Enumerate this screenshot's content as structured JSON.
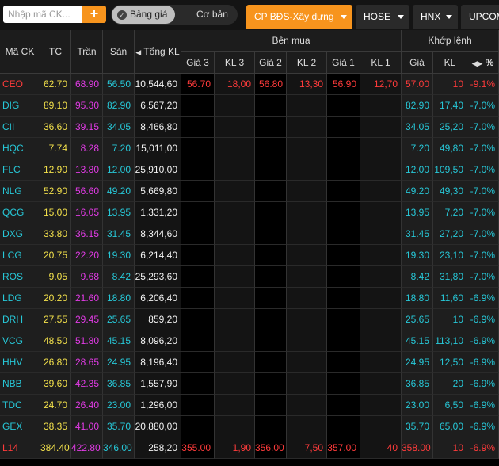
{
  "search": {
    "placeholder": "Nhập mã CK..."
  },
  "add_button": "+",
  "view_toggle": {
    "active": "Bảng giá",
    "other": "Cơ bản"
  },
  "tabs": [
    {
      "label": "CP BĐS-Xây dựng",
      "active": true
    },
    {
      "label": "HOSE",
      "active": false
    },
    {
      "label": "HNX",
      "active": false
    },
    {
      "label": "UPCOM",
      "active": false
    }
  ],
  "headers": {
    "symbol": "Mã CK",
    "ref": "TC",
    "ceiling": "Trần",
    "floor": "Sàn",
    "total_vol": "Tổng KL",
    "buy_group": "Bên mua",
    "match_group": "Khớp lệnh",
    "price3": "Giá 3",
    "vol3": "KL 3",
    "price2": "Giá 2",
    "vol2": "KL 2",
    "price1": "Giá 1",
    "vol1": "KL 1",
    "match_price": "Giá",
    "match_vol": "KL",
    "pct": "%"
  },
  "colors": {
    "accent": "#f7941d",
    "ref": "#f2e04b",
    "ceiling": "#e23be6",
    "floor": "#27c8d8",
    "up": "#ff3b3b"
  },
  "rows": [
    {
      "sym": "CEO",
      "tc": "62.70",
      "tran": "68.90",
      "san": "56.50",
      "tkl": "10,544,60",
      "g3": "56.70",
      "kl3": "18,00",
      "g2": "56.80",
      "kl2": "13,30",
      "g1": "56.90",
      "kl1": "12,70",
      "gia": "57.00",
      "kl": "10",
      "pct": "-9.1%",
      "status": "up"
    },
    {
      "sym": "DIG",
      "tc": "89.10",
      "tran": "95.30",
      "san": "82.90",
      "tkl": "6,567,20",
      "g3": "",
      "kl3": "",
      "g2": "",
      "kl2": "",
      "g1": "",
      "kl1": "",
      "gia": "82.90",
      "kl": "17,40",
      "pct": "-7.0%",
      "status": "floor"
    },
    {
      "sym": "CII",
      "tc": "36.60",
      "tran": "39.15",
      "san": "34.05",
      "tkl": "8,466,80",
      "g3": "",
      "kl3": "",
      "g2": "",
      "kl2": "",
      "g1": "",
      "kl1": "",
      "gia": "34.05",
      "kl": "25,20",
      "pct": "-7.0%",
      "status": "floor"
    },
    {
      "sym": "HQC",
      "tc": "7.74",
      "tran": "8.28",
      "san": "7.20",
      "tkl": "15,011,00",
      "g3": "",
      "kl3": "",
      "g2": "",
      "kl2": "",
      "g1": "",
      "kl1": "",
      "gia": "7.20",
      "kl": "49,80",
      "pct": "-7.0%",
      "status": "floor"
    },
    {
      "sym": "FLC",
      "tc": "12.90",
      "tran": "13.80",
      "san": "12.00",
      "tkl": "25,910,00",
      "g3": "",
      "kl3": "",
      "g2": "",
      "kl2": "",
      "g1": "",
      "kl1": "",
      "gia": "12.00",
      "kl": "109,50",
      "pct": "-7.0%",
      "status": "floor"
    },
    {
      "sym": "NLG",
      "tc": "52.90",
      "tran": "56.60",
      "san": "49.20",
      "tkl": "5,669,80",
      "g3": "",
      "kl3": "",
      "g2": "",
      "kl2": "",
      "g1": "",
      "kl1": "",
      "gia": "49.20",
      "kl": "49,30",
      "pct": "-7.0%",
      "status": "floor"
    },
    {
      "sym": "QCG",
      "tc": "15.00",
      "tran": "16.05",
      "san": "13.95",
      "tkl": "1,331,20",
      "g3": "",
      "kl3": "",
      "g2": "",
      "kl2": "",
      "g1": "",
      "kl1": "",
      "gia": "13.95",
      "kl": "7,20",
      "pct": "-7.0%",
      "status": "floor"
    },
    {
      "sym": "DXG",
      "tc": "33.80",
      "tran": "36.15",
      "san": "31.45",
      "tkl": "8,344,60",
      "g3": "",
      "kl3": "",
      "g2": "",
      "kl2": "",
      "g1": "",
      "kl1": "",
      "gia": "31.45",
      "kl": "27,20",
      "pct": "-7.0%",
      "status": "floor"
    },
    {
      "sym": "LCG",
      "tc": "20.75",
      "tran": "22.20",
      "san": "19.30",
      "tkl": "6,214,40",
      "g3": "",
      "kl3": "",
      "g2": "",
      "kl2": "",
      "g1": "",
      "kl1": "",
      "gia": "19.30",
      "kl": "23,10",
      "pct": "-7.0%",
      "status": "floor"
    },
    {
      "sym": "ROS",
      "tc": "9.05",
      "tran": "9.68",
      "san": "8.42",
      "tkl": "25,293,60",
      "g3": "",
      "kl3": "",
      "g2": "",
      "kl2": "",
      "g1": "",
      "kl1": "",
      "gia": "8.42",
      "kl": "31,80",
      "pct": "-7.0%",
      "status": "floor"
    },
    {
      "sym": "LDG",
      "tc": "20.20",
      "tran": "21.60",
      "san": "18.80",
      "tkl": "6,206,40",
      "g3": "",
      "kl3": "",
      "g2": "",
      "kl2": "",
      "g1": "",
      "kl1": "",
      "gia": "18.80",
      "kl": "11,60",
      "pct": "-6.9%",
      "status": "floor"
    },
    {
      "sym": "DRH",
      "tc": "27.55",
      "tran": "29.45",
      "san": "25.65",
      "tkl": "859,20",
      "g3": "",
      "kl3": "",
      "g2": "",
      "kl2": "",
      "g1": "",
      "kl1": "",
      "gia": "25.65",
      "kl": "10",
      "pct": "-6.9%",
      "status": "floor"
    },
    {
      "sym": "VCG",
      "tc": "48.50",
      "tran": "51.80",
      "san": "45.15",
      "tkl": "8,096,20",
      "g3": "",
      "kl3": "",
      "g2": "",
      "kl2": "",
      "g1": "",
      "kl1": "",
      "gia": "45.15",
      "kl": "113,10",
      "pct": "-6.9%",
      "status": "floor"
    },
    {
      "sym": "HHV",
      "tc": "26.80",
      "tran": "28.65",
      "san": "24.95",
      "tkl": "8,196,40",
      "g3": "",
      "kl3": "",
      "g2": "",
      "kl2": "",
      "g1": "",
      "kl1": "",
      "gia": "24.95",
      "kl": "12,50",
      "pct": "-6.9%",
      "status": "floor"
    },
    {
      "sym": "NBB",
      "tc": "39.60",
      "tran": "42.35",
      "san": "36.85",
      "tkl": "1,557,90",
      "g3": "",
      "kl3": "",
      "g2": "",
      "kl2": "",
      "g1": "",
      "kl1": "",
      "gia": "36.85",
      "kl": "20",
      "pct": "-6.9%",
      "status": "floor"
    },
    {
      "sym": "TDC",
      "tc": "24.70",
      "tran": "26.40",
      "san": "23.00",
      "tkl": "1,296,00",
      "g3": "",
      "kl3": "",
      "g2": "",
      "kl2": "",
      "g1": "",
      "kl1": "",
      "gia": "23.00",
      "kl": "6,50",
      "pct": "-6.9%",
      "status": "floor"
    },
    {
      "sym": "GEX",
      "tc": "38.35",
      "tran": "41.00",
      "san": "35.70",
      "tkl": "20,880,00",
      "g3": "",
      "kl3": "",
      "g2": "",
      "kl2": "",
      "g1": "",
      "kl1": "",
      "gia": "35.70",
      "kl": "65,00",
      "pct": "-6.9%",
      "status": "floor"
    },
    {
      "sym": "L14",
      "tc": "384.40",
      "tran": "422.80",
      "san": "346.00",
      "tkl": "258,20",
      "g3": "355.00",
      "kl3": "1,90",
      "g2": "356.00",
      "kl2": "7,50",
      "g1": "357.00",
      "kl1": "40",
      "gia": "358.00",
      "kl": "10",
      "pct": "-6.9%",
      "status": "up"
    }
  ]
}
